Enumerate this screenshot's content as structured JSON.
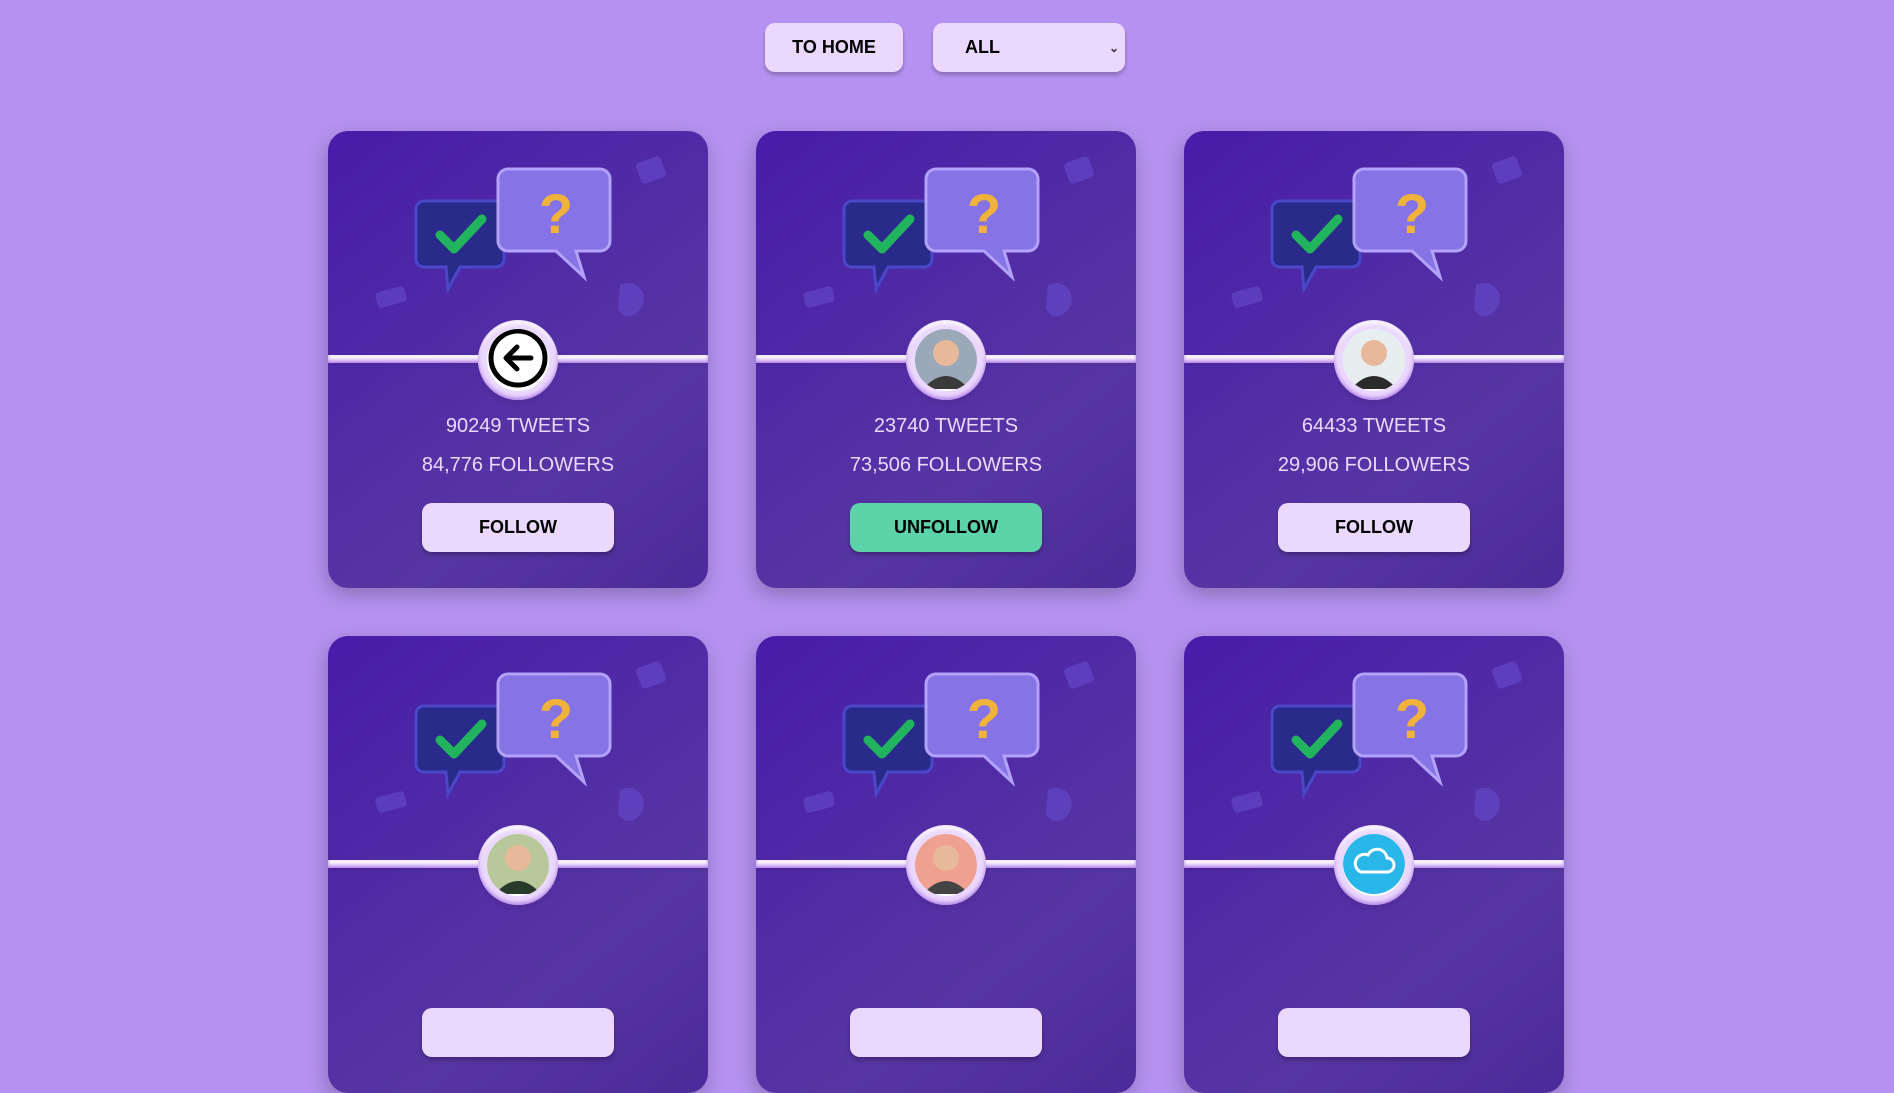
{
  "toolbar": {
    "home_label": "TO HOME",
    "filter_selected": "ALL"
  },
  "colors": {
    "background": "#b592f1",
    "card_start": "#471ca9",
    "card_end": "#5736a3",
    "accent_light": "#ebd8ff",
    "following": "#5cd3a8"
  },
  "cards": [
    {
      "avatar": "back-arrow-icon",
      "tweets": "90249 TWEETS",
      "followers": "84,776 FOLLOWERS",
      "button": "FOLLOW",
      "following": false
    },
    {
      "avatar": "user-photo",
      "tweets": "23740 TWEETS",
      "followers": "73,506 FOLLOWERS",
      "button": "UNFOLLOW",
      "following": true
    },
    {
      "avatar": "user-photo",
      "tweets": "64433 TWEETS",
      "followers": "29,906 FOLLOWERS",
      "button": "FOLLOW",
      "following": false
    },
    {
      "avatar": "user-photo",
      "tweets": "",
      "followers": "",
      "button": "",
      "following": false
    },
    {
      "avatar": "user-photo",
      "tweets": "",
      "followers": "",
      "button": "",
      "following": false
    },
    {
      "avatar": "cloud-icon",
      "tweets": "",
      "followers": "",
      "button": "",
      "following": false
    }
  ]
}
